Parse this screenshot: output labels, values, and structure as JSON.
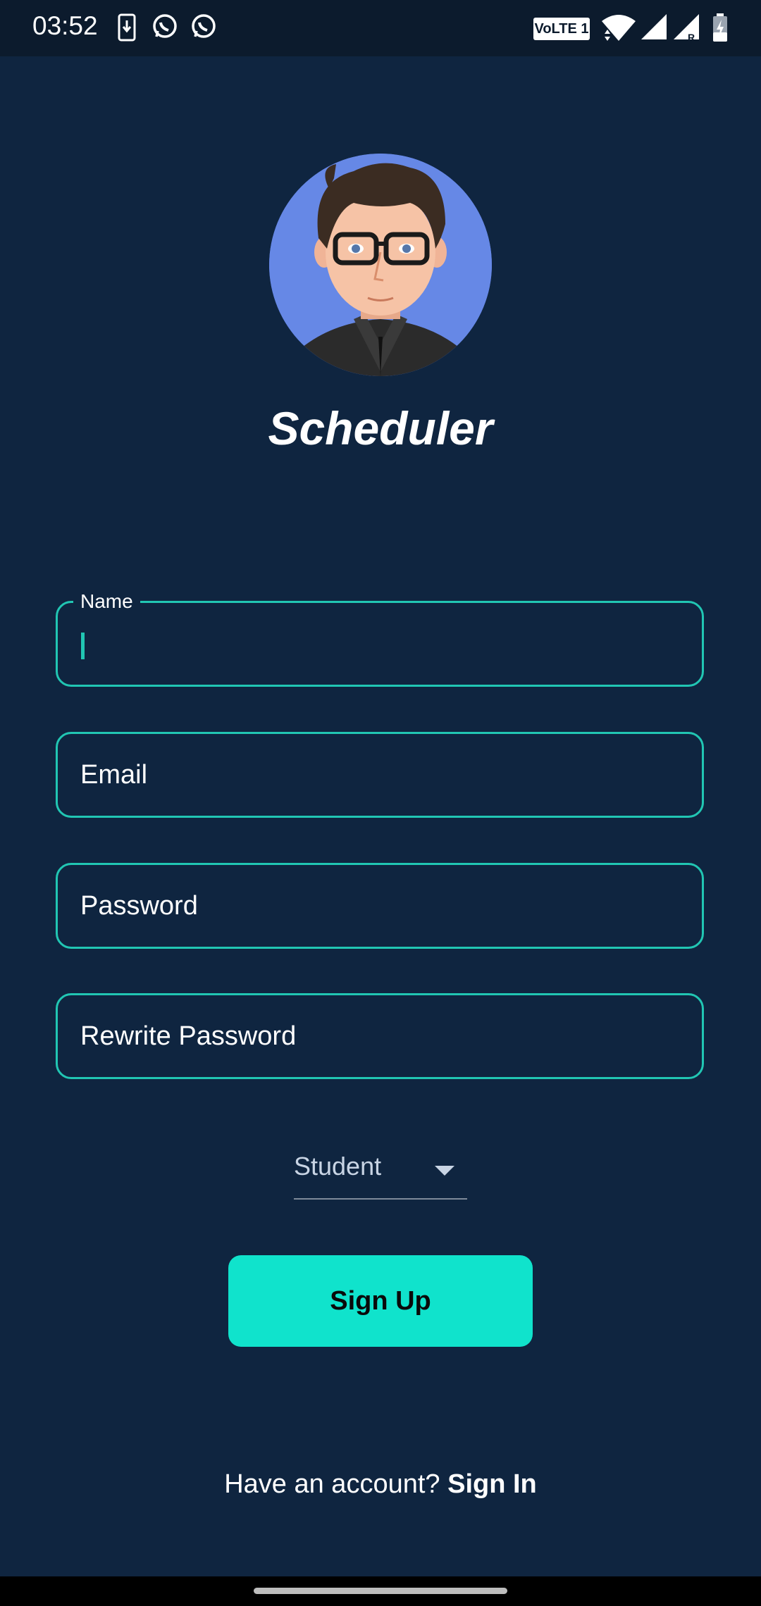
{
  "status_bar": {
    "time": "03:52",
    "left_icons": [
      "download-icon",
      "whatsapp-icon",
      "whatsapp-icon"
    ],
    "volte_label": "VoLTE 1",
    "right_icons": [
      "wifi-icon",
      "signal-icon",
      "signal-roaming-icon",
      "battery-charging-icon"
    ]
  },
  "app": {
    "title": "Scheduler"
  },
  "form": {
    "name_label": "Name",
    "name_value": "",
    "email_placeholder": "Email",
    "password_placeholder": "Password",
    "rewrite_password_placeholder": "Rewrite Password",
    "role_selected": "Student"
  },
  "actions": {
    "signup_label": "Sign Up",
    "have_account_text": "Have an account?",
    "signin_label": "Sign In"
  },
  "colors": {
    "background": "#0f2540",
    "accent": "#21c6b3",
    "button": "#10e3cc"
  }
}
